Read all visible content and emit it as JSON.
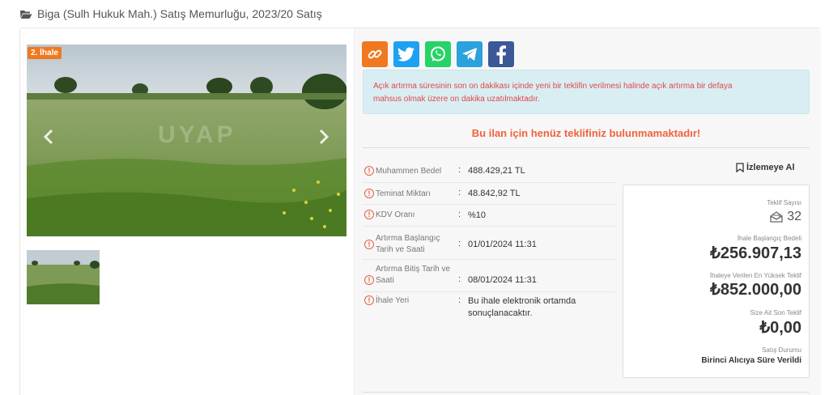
{
  "breadcrumb": {
    "icon": "folder-open-icon",
    "title": "Biga (Sulh Hukuk Mah.) Satış Memurluğu, 2023/20 Satış"
  },
  "gallery": {
    "badge": "2. İhale",
    "watermark": "UYAP"
  },
  "share": {
    "buttons": [
      {
        "name": "link-share-button",
        "icon": "link-icon",
        "color": "#f07820"
      },
      {
        "name": "twitter-share-button",
        "icon": "twitter-icon",
        "color": "#1da1f2"
      },
      {
        "name": "whatsapp-share-button",
        "icon": "whatsapp-icon",
        "color": "#25d366"
      },
      {
        "name": "telegram-share-button",
        "icon": "telegram-icon",
        "color": "#2ba1dd"
      },
      {
        "name": "facebook-share-button",
        "icon": "facebook-icon",
        "color": "#3b5998"
      }
    ]
  },
  "notice": {
    "line1": "Açık artırma süresinin son on dakikası içinde yeni bir teklifin verilmesi halinde açık artırma bir defaya",
    "line2": "mahsus olmak üzere on dakika uzatılmaktadır."
  },
  "no_bid_message": "Bu ilan için henüz teklifiniz bulunmamaktadır!",
  "details": [
    {
      "label": "Muhammen Bedel",
      "label2": "",
      "value": "488.429,21 TL",
      "value2": ""
    },
    {
      "label": "Teminat Miktarı",
      "label2": "",
      "value": "48.842,92 TL",
      "value2": ""
    },
    {
      "label": "KDV Oranı",
      "label2": "",
      "value": "%10",
      "value2": ""
    },
    {
      "label": "Artırma Başlangıç",
      "label2": "Tarih ve Saati",
      "value": "01/01/2024 11:31",
      "value2": ""
    },
    {
      "label": "Artırma Bitiş Tarih ve",
      "label2": "Saati",
      "value": "08/01/2024 11:31",
      "value2": ""
    },
    {
      "label": "İhale Yeri",
      "label2": "",
      "value": "Bu ihale elektronik ortamda",
      "value2": "sonuçlanacaktır."
    }
  ],
  "watch_label": "İzlemeye Al",
  "stats": {
    "bid_count_label": "Teklif Sayısı",
    "bid_count": "32",
    "start_price_label": "İhale Başlangıç Bedeli",
    "start_price": "₺256.907,13",
    "highest_bid_label": "İhaleye Verilen En Yüksek Teklif",
    "highest_bid": "₺852.000,00",
    "your_last_bid_label": "Size Ait Son Teklif",
    "your_last_bid": "₺0,00",
    "status_label": "Satış Durumu",
    "status": "Birinci Alıcıya Süre Verildi"
  },
  "colors": {
    "accent": "#f07820",
    "warning_text": "#e04848",
    "notice_bg": "#d9eef3",
    "no_bid_text": "#f0623c"
  }
}
